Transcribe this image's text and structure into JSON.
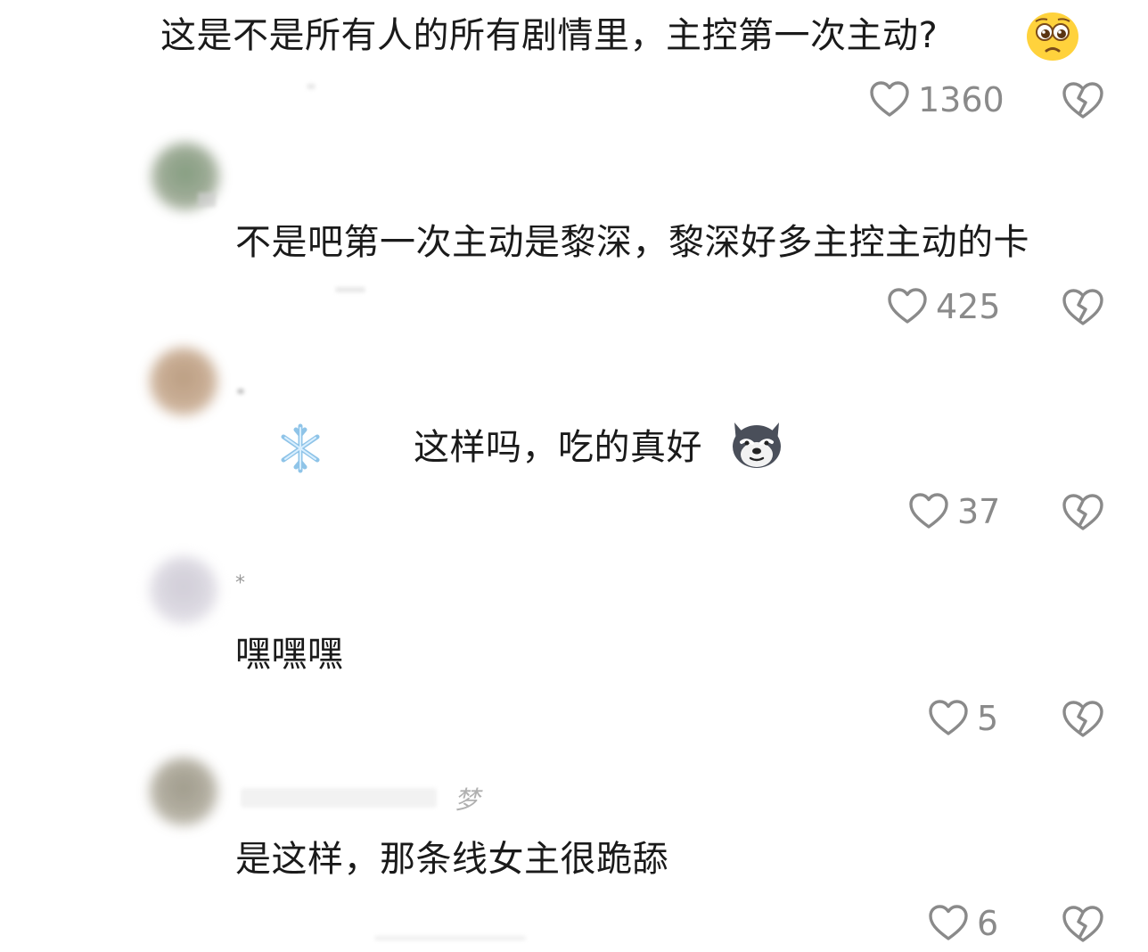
{
  "comments": [
    {
      "text": "这是不是所有人的所有剧情里，主控第一次主动?",
      "likes": "1360",
      "emoji": "pleading-face"
    },
    {
      "text": "不是吧第一次主动是黎深，黎深好多主控主动的卡",
      "likes": "425"
    },
    {
      "text": "这样吗，吃的真好",
      "likes": "37",
      "emoji": "smirking-husky",
      "decor": "snowflake-sticker"
    },
    {
      "text": "嘿嘿嘿",
      "likes": "5"
    },
    {
      "text": "是这样，那条线女主很跪舔",
      "likes": "6"
    }
  ],
  "colors": {
    "icon": "#8a8a8a",
    "text": "#1a1a1a",
    "count": "#8a8a8a"
  },
  "faint_marks": [
    "*",
    "梦"
  ]
}
